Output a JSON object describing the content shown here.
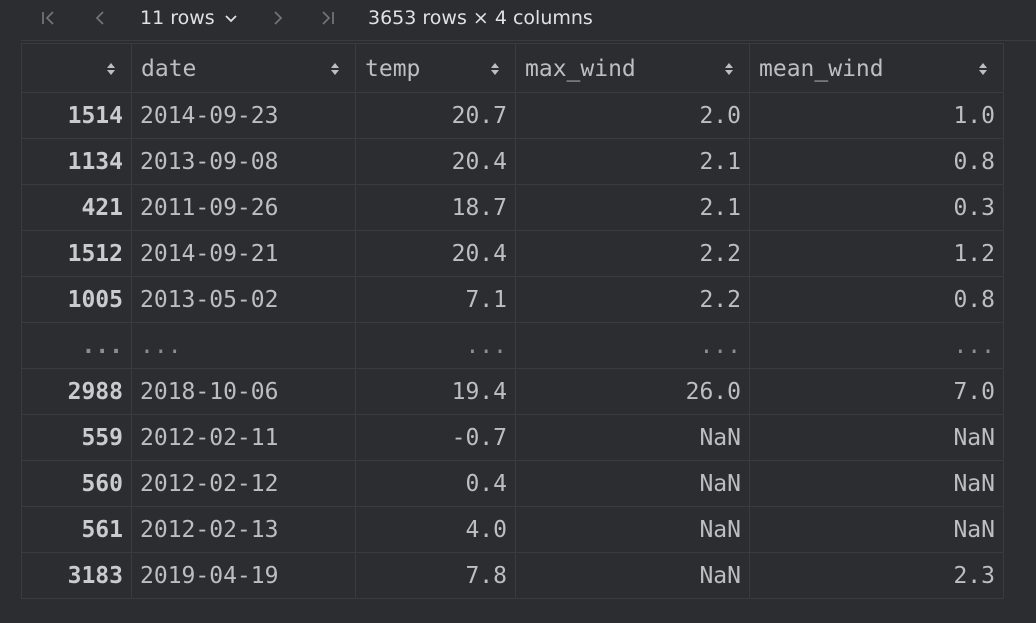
{
  "toolbar": {
    "first_page_icon": "first-page-icon",
    "prev_page_icon": "chevron-left-icon",
    "rows_select_value": "11 rows",
    "next_page_icon": "chevron-right-icon",
    "last_page_icon": "last-page-icon",
    "summary": "3653 rows × 4 columns"
  },
  "columns": [
    "",
    "date",
    "temp",
    "max_wind",
    "mean_wind"
  ],
  "rows": [
    {
      "index": "1514",
      "date": "2014-09-23",
      "temp": "20.7",
      "max_wind": "2.0",
      "mean_wind": "1.0"
    },
    {
      "index": "1134",
      "date": "2013-09-08",
      "temp": "20.4",
      "max_wind": "2.1",
      "mean_wind": "0.8"
    },
    {
      "index": "421",
      "date": "2011-09-26",
      "temp": "18.7",
      "max_wind": "2.1",
      "mean_wind": "0.3"
    },
    {
      "index": "1512",
      "date": "2014-09-21",
      "temp": "20.4",
      "max_wind": "2.2",
      "mean_wind": "1.2"
    },
    {
      "index": "1005",
      "date": "2013-05-02",
      "temp": "7.1",
      "max_wind": "2.2",
      "mean_wind": "0.8"
    },
    {
      "index": "...",
      "date": "...",
      "temp": "...",
      "max_wind": "...",
      "mean_wind": "..."
    },
    {
      "index": "2988",
      "date": "2018-10-06",
      "temp": "19.4",
      "max_wind": "26.0",
      "mean_wind": "7.0"
    },
    {
      "index": "559",
      "date": "2012-02-11",
      "temp": "-0.7",
      "max_wind": "NaN",
      "mean_wind": "NaN"
    },
    {
      "index": "560",
      "date": "2012-02-12",
      "temp": "0.4",
      "max_wind": "NaN",
      "mean_wind": "NaN"
    },
    {
      "index": "561",
      "date": "2012-02-13",
      "temp": "4.0",
      "max_wind": "NaN",
      "mean_wind": "NaN"
    },
    {
      "index": "3183",
      "date": "2019-04-19",
      "temp": "7.8",
      "max_wind": "NaN",
      "mean_wind": "2.3"
    }
  ],
  "colors": {
    "background": "#2b2d30",
    "grid_line": "#393b40",
    "text": "#bcbec4",
    "muted_icon": "#6f737a"
  }
}
